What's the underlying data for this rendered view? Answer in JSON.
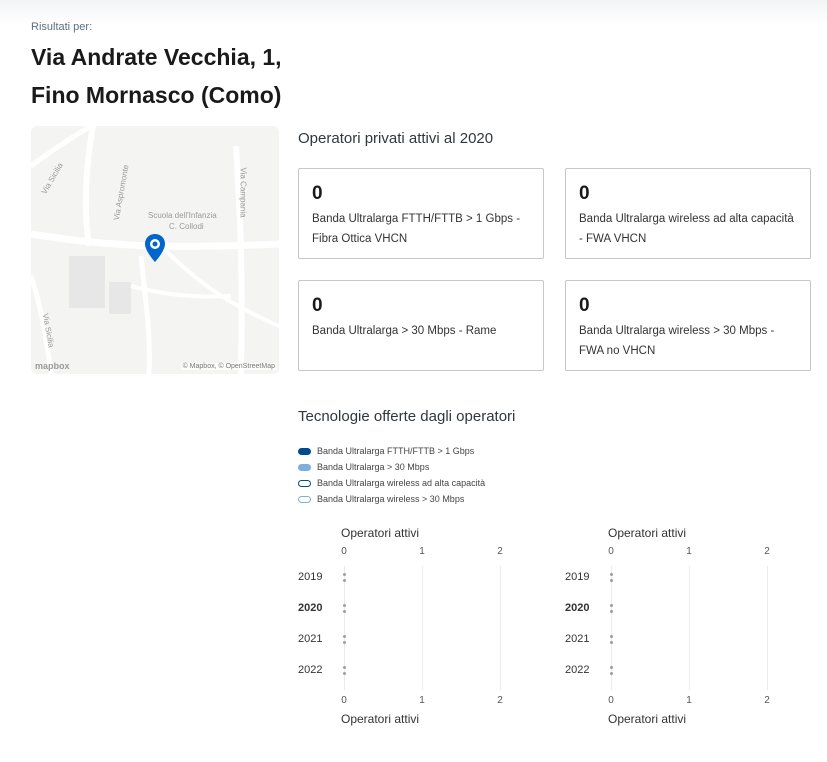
{
  "header": {
    "results_label": "Risultati per:",
    "address_line1": "Via Andrate Vecchia, 1,",
    "address_line2": "Fino Mornasco (Como)"
  },
  "map": {
    "labels": [
      "Via Sicilia",
      "Via Aspromonte",
      "Via Campania",
      "Scuola dell'Infanzia",
      "C. Collodi",
      "Via Sicilia"
    ],
    "attribution": "© Mapbox, © OpenStreetMap",
    "logo": "mapbox",
    "marker_icon": "map-pin-icon",
    "marker_color": "#0066cc"
  },
  "operators": {
    "title": "Operatori privati attivi al 2020",
    "cards": [
      {
        "value": "0",
        "label": "Banda Ultralarga FTTH/FTTB > 1 Gbps - Fibra Ottica VHCN",
        "color": "#004b8d"
      },
      {
        "value": "0",
        "label": "Banda Ultralarga wireless ad alta capacità - FWA VHCN",
        "color": "#004b8d"
      },
      {
        "value": "0",
        "label": "Banda Ultralarga > 30 Mbps - Rame",
        "color": "#7eaedc"
      },
      {
        "value": "0",
        "label": "Banda Ultralarga wireless > 30 Mbps - FWA no VHCN",
        "color": "#7eaedc"
      }
    ]
  },
  "technologies": {
    "title": "Tecnologie offerte dagli operatori",
    "legend": [
      {
        "label": "Banda Ultralarga FTTH/FTTB > 1 Gbps",
        "style": "filled",
        "color": "#004b8d"
      },
      {
        "label": "Banda Ultralarga > 30 Mbps",
        "style": "filled",
        "color": "#7eaedc"
      },
      {
        "label": "Banda Ultralarga wireless ad alta capacità",
        "style": "outline",
        "color": "#004b8d"
      },
      {
        "label": "Banda Ultralarga wireless > 30 Mbps",
        "style": "outline",
        "color": "#7eaedc"
      }
    ]
  },
  "chart_data": [
    {
      "type": "bar",
      "orientation": "horizontal",
      "categories": [
        "2019",
        "2020",
        "2021",
        "2022"
      ],
      "highlighted_category": "2020",
      "xlabel": "Operatori attivi",
      "xticks": [
        "0",
        "1",
        "2"
      ],
      "xlim": [
        0,
        2
      ],
      "series": [
        {
          "name": "Banda Ultralarga FTTH/FTTB > 1 Gbps",
          "values": [
            0,
            0,
            0,
            0
          ]
        },
        {
          "name": "Banda Ultralarga > 30 Mbps",
          "values": [
            0,
            0,
            0,
            0
          ]
        }
      ]
    },
    {
      "type": "bar",
      "orientation": "horizontal",
      "categories": [
        "2019",
        "2020",
        "2021",
        "2022"
      ],
      "highlighted_category": "2020",
      "xlabel": "Operatori attivi",
      "xticks": [
        "0",
        "1",
        "2"
      ],
      "xlim": [
        0,
        2
      ],
      "series": [
        {
          "name": "Banda Ultralarga wireless ad alta capacità",
          "values": [
            0,
            0,
            0,
            0
          ]
        },
        {
          "name": "Banda Ultralarga wireless > 30 Mbps",
          "values": [
            0,
            0,
            0,
            0
          ]
        }
      ]
    }
  ]
}
